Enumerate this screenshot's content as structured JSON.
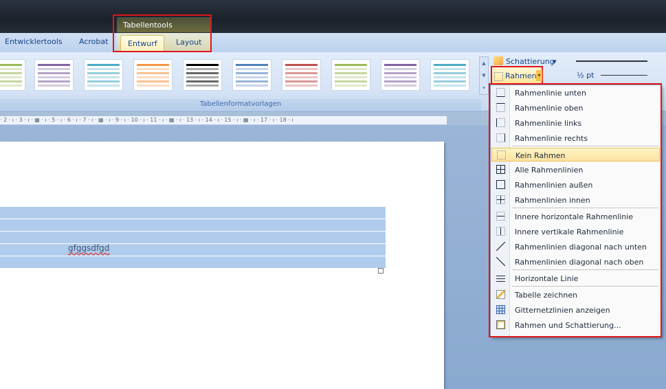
{
  "contextual_group": {
    "title": "Tabellentools"
  },
  "ribbon_tabs": {
    "developer": "Entwicklertools",
    "acrobat": "Acrobat",
    "design": "Entwurf",
    "layout": "Layout"
  },
  "ribbon": {
    "group_label": "Tabellenformatvorlagen",
    "shading_label": "Schattierung",
    "borders_label": "Rahmen",
    "pen_weight": "½ pt",
    "table_style_colors": [
      "#9bbb59",
      "#8064a2",
      "#4bacc6",
      "#f79646",
      "#000000",
      "#4f81bd",
      "#c0504d",
      "#9bbb59",
      "#8064a2",
      "#4bacc6"
    ]
  },
  "ruler": {
    "text": "· 2 · ı · 3 · ı · ▦ · ı · 5 · ı · 6 · ı · 7 · ı · ▦ · ı · 9 · ı · 10 · ı · 11 · ı · ▦ · ı · 13 · ı · 14 · ı · 15 · ı · ▦ · ı · 17 · ı · 18 · ı"
  },
  "document": {
    "cell_text": "gfggsdfgd"
  },
  "borders_menu": {
    "items": [
      {
        "label": "Rahmenlinie unten",
        "icon": "border-bottom-icon"
      },
      {
        "label": "Rahmenlinie oben",
        "icon": "border-top-icon"
      },
      {
        "label": "Rahmenlinie links",
        "icon": "border-left-icon"
      },
      {
        "label": "Rahmenlinie rechts",
        "icon": "border-right-icon"
      },
      {
        "label": "Kein Rahmen",
        "icon": "no-border-icon"
      },
      {
        "label": "Alle Rahmenlinien",
        "icon": "all-borders-icon"
      },
      {
        "label": "Rahmenlinien außen",
        "icon": "outside-borders-icon"
      },
      {
        "label": "Rahmenlinien innen",
        "icon": "inside-borders-icon"
      },
      {
        "label": "Innere horizontale Rahmenlinie",
        "icon": "inside-horizontal-border-icon"
      },
      {
        "label": "Innere vertikale Rahmenlinie",
        "icon": "inside-vertical-border-icon"
      },
      {
        "label": "Rahmenlinien diagonal nach unten",
        "icon": "diagonal-down-border-icon"
      },
      {
        "label": "Rahmenlinien diagonal nach oben",
        "icon": "diagonal-up-border-icon"
      },
      {
        "label": "Horizontale Linie",
        "icon": "horizontal-line-icon"
      },
      {
        "label": "Tabelle zeichnen",
        "icon": "draw-table-icon"
      },
      {
        "label": "Gitternetzlinien anzeigen",
        "icon": "view-gridlines-icon"
      },
      {
        "label": "Rahmen und Schattierung...",
        "icon": "borders-shading-dialog-icon"
      }
    ]
  }
}
